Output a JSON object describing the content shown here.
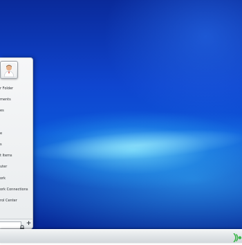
{
  "desktop": {
    "wallpaper": "blue-light-streak",
    "colors": {
      "deep": "#0a2a9a",
      "mid": "#0f45cf",
      "glow": "#78e6ff"
    }
  },
  "start_menu": {
    "avatar": {
      "icon": "user-avatar-icon"
    },
    "items": [
      {
        "label": "r Folder",
        "icon": "none"
      },
      {
        "label": "ments",
        "icon": "none"
      },
      {
        "label": "es",
        "icon": "none"
      },
      {
        "label": "",
        "icon": "none"
      },
      {
        "label": "e",
        "icon": "none"
      },
      {
        "label": "s",
        "icon": "none"
      },
      {
        "label": "t Items",
        "icon": "none"
      },
      {
        "label": "uter",
        "icon": "none"
      },
      {
        "label": "ork",
        "icon": "none"
      },
      {
        "label": "ork Connections",
        "icon": "none"
      },
      {
        "label": "rol Center",
        "icon": "none"
      }
    ],
    "bottom": {
      "search_placeholder": "",
      "lock_icon": "lock-icon",
      "add_label": "+"
    }
  },
  "taskbar": {
    "tray": {
      "network_icon": "network-signal-icon",
      "accent": "#3bb54a"
    }
  }
}
